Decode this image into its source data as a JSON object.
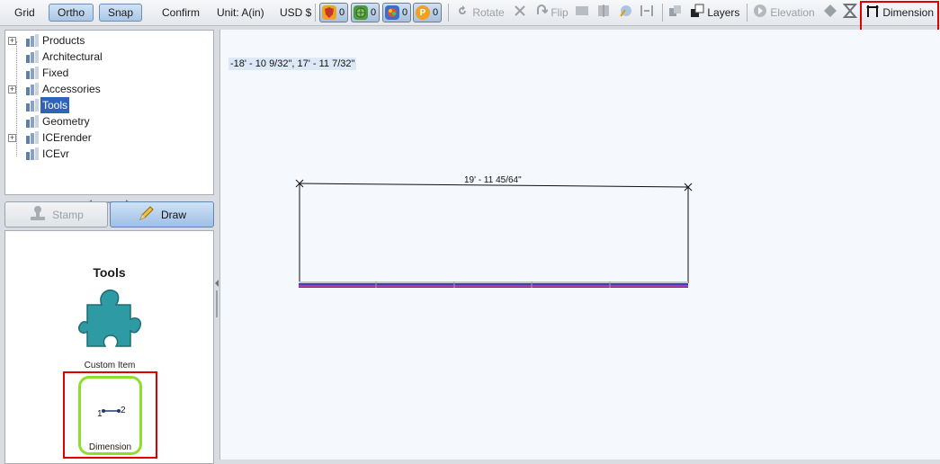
{
  "toolbar": {
    "grid": "Grid",
    "ortho": "Ortho",
    "snap": "Snap",
    "confirm": "Confirm",
    "unit": "Unit: A(in)",
    "currency": "USD $",
    "counters": [
      {
        "icon": "shield-icon",
        "value": "0",
        "color": "#f2a31b"
      },
      {
        "icon": "globe-icon",
        "value": "0",
        "color": "#4b9a3c"
      },
      {
        "icon": "palette-icon",
        "value": "0",
        "color": "#3a6fc9"
      },
      {
        "icon": "p-coin-icon",
        "value": "0",
        "color": "#f1a020"
      }
    ],
    "rotate": "Rotate",
    "flip": "Flip",
    "layers": "Layers",
    "elevation": "Elevation",
    "dimension": "Dimension"
  },
  "tree": {
    "items": [
      {
        "label": "Products",
        "expandable": true
      },
      {
        "label": "Architectural",
        "expandable": false
      },
      {
        "label": "Fixed",
        "expandable": false
      },
      {
        "label": "Accessories",
        "expandable": true
      },
      {
        "label": "Tools",
        "expandable": false,
        "selected": true
      },
      {
        "label": "Geometry",
        "expandable": false
      },
      {
        "label": "ICErender",
        "expandable": true
      },
      {
        "label": "ICEvr",
        "expandable": false
      }
    ]
  },
  "modes": {
    "stamp": "Stamp",
    "draw": "Draw"
  },
  "tools_panel": {
    "title": "Tools",
    "custom_item": "Custom Item",
    "dimension": "Dimension",
    "dim_point_1": "1",
    "dim_point_2": "2"
  },
  "canvas": {
    "coordinates": "-18' - 10 9/32\", 17' - 11 7/32\"",
    "dimension_label": "19' - 11 45/64\""
  },
  "colors": {
    "selection": "#2d63b8",
    "highlight_red": "#e00000",
    "highlight_green": "#8be02e",
    "wall_blue": "#3b3fb8",
    "puzzle_teal": "#2e9aa3"
  }
}
